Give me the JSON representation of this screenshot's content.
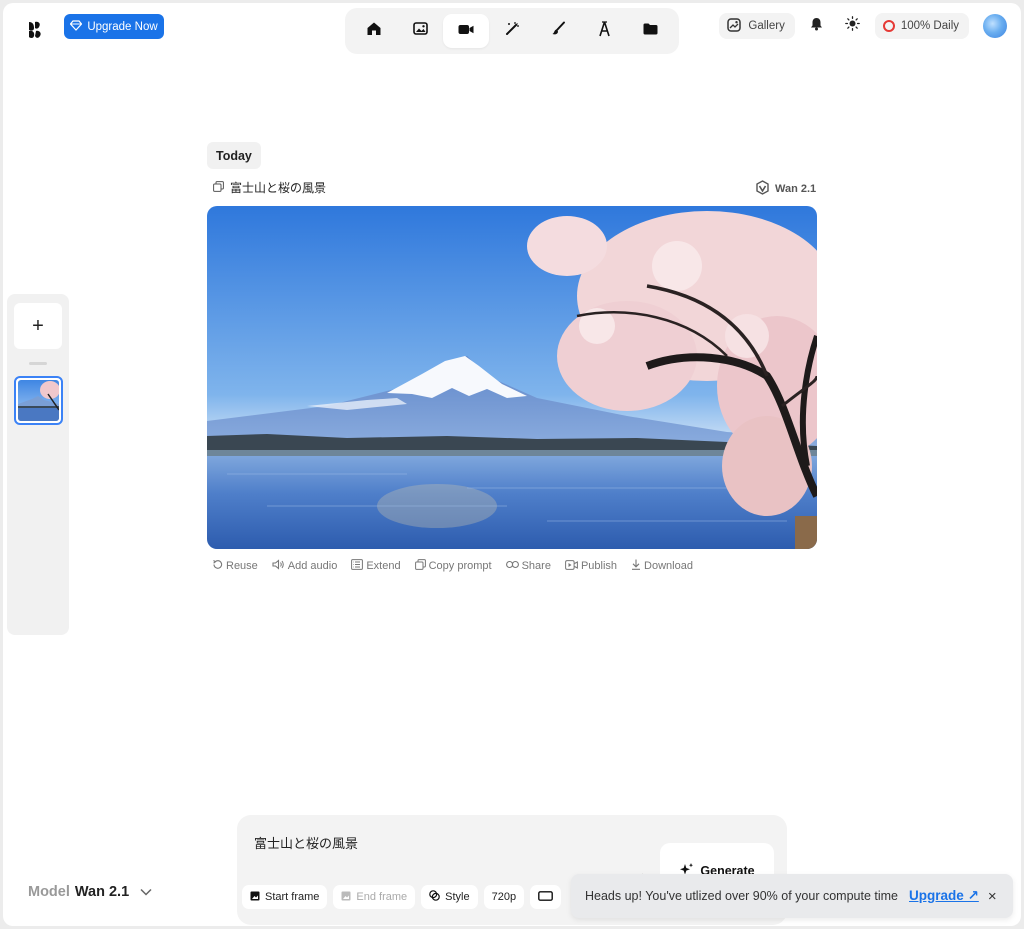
{
  "header": {
    "upgrade_label": "Upgrade Now",
    "nav_items": [
      "home-icon",
      "image-icon",
      "video-icon",
      "magic-wand-icon",
      "brush-icon",
      "text-icon",
      "folder-icon"
    ],
    "active_nav": "video-icon",
    "gallery_label": "Gallery",
    "daily_label": "100% Daily"
  },
  "sidebar": {
    "add_label": "+"
  },
  "main": {
    "date_label": "Today",
    "prompt_title": "富士山と桜の風景",
    "model_tag": "Wan 2.1",
    "actions": [
      {
        "icon": "reuse-icon",
        "label": "Reuse"
      },
      {
        "icon": "audio-icon",
        "label": "Add audio"
      },
      {
        "icon": "extend-icon",
        "label": "Extend"
      },
      {
        "icon": "copy-icon",
        "label": "Copy prompt"
      },
      {
        "icon": "link-icon",
        "label": "Share"
      },
      {
        "icon": "publish-icon",
        "label": "Publish"
      },
      {
        "icon": "download-icon",
        "label": "Download"
      }
    ]
  },
  "composer": {
    "model_label": "Model",
    "model_value": "Wan 2.1",
    "prompt_text": "富士山と桜の風景",
    "generate_label": "Generate",
    "tools": {
      "start_frame": "Start frame",
      "end_frame": "End frame",
      "style": "Style",
      "resolution": "720p"
    }
  },
  "toast": {
    "message": "Heads up! You've utlized over 90% of your compute time",
    "link_label": "Upgrade ↗",
    "close_label": "×"
  },
  "colors": {
    "accent": "#1a73e8",
    "selected_border": "#3b82f6",
    "daily_ring": "#e53935"
  }
}
